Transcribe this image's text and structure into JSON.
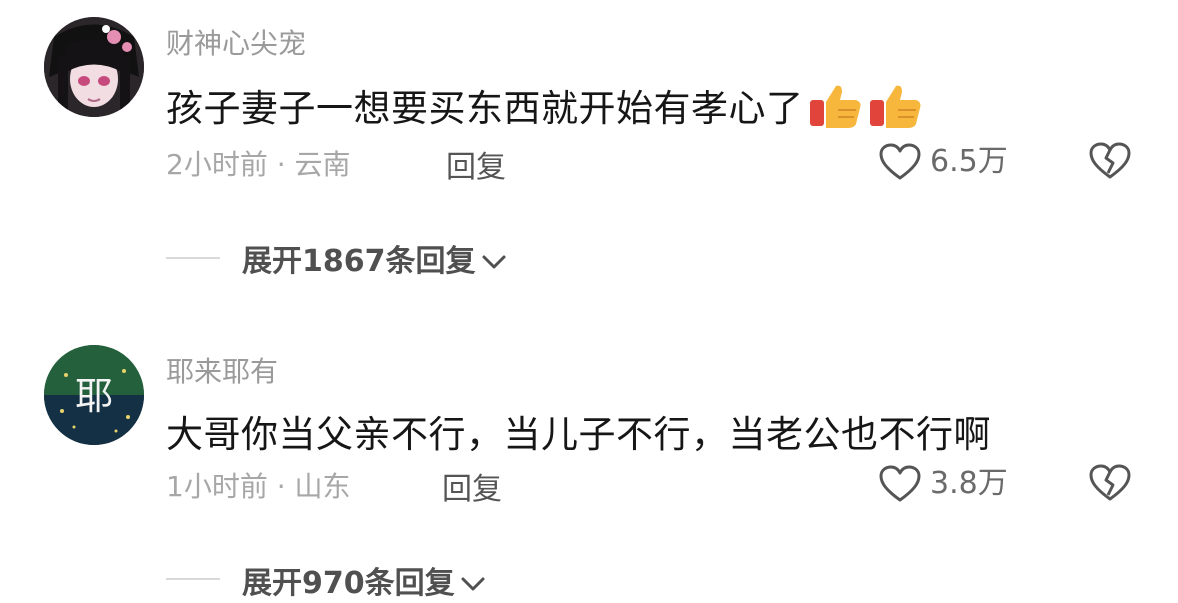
{
  "comments": [
    {
      "username": "财神心尖宠",
      "text": "孩子妻子一想要买东西就开始有孝心了",
      "emojis": [
        "thumbs-up-icon",
        "thumbs-up-icon"
      ],
      "time_location": "2小时前 · 云南",
      "reply_label": "回复",
      "likes": "6.5万",
      "expand_label": "展开1867条回复"
    },
    {
      "username": "耶来耶有",
      "text": "大哥你当父亲不行，当儿子不行，当老公也不行啊",
      "avatar_glyph": "耶",
      "time_location": "1小时前 · 山东",
      "reply_label": "回复",
      "likes": "3.8万",
      "expand_label": "展开970条回复"
    }
  ],
  "colors": {
    "username": "#9a9a9a",
    "text": "#161616",
    "meta": "#a7a7a7",
    "accent_thumb": "#f6b73c"
  }
}
